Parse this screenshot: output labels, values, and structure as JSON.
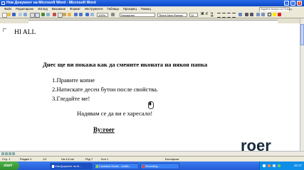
{
  "window": {
    "title": "Нов Документ на Microsoft Word - Microsoft Word",
    "help_placeholder": "Задайте въпрос за Помощ",
    "controls": {
      "minimize": "_",
      "maximize": "□",
      "close": "x"
    }
  },
  "menu": [
    "Файл",
    "Редактиране",
    "Изглед",
    "Вмъкване",
    "Формат",
    "Инструменти",
    "Таблица",
    "Прозорец",
    "Помощ"
  ],
  "toolbar": {
    "zoom": "100%",
    "style": "Нормален",
    "font": "Times New Roman",
    "font_size": "12"
  },
  "document": {
    "heading": "HI ALL",
    "intro": "Днес ще ви покажа как да смените иконата на някоя папка",
    "steps": [
      "1.Правите копие",
      "2.Натискате десен бутон после свойства.",
      "3.Гледайте ме!"
    ],
    "closing": "Надявам се да ви е харесало!",
    "signature": "By:roer"
  },
  "watermark": "roer",
  "statusbar": {
    "page": "Стр. 1",
    "section": "Раздел 1",
    "page_of": "1/1",
    "at": "На 4,8 см",
    "line": "Ред 7",
    "column": "Кол 1",
    "language": "Български"
  },
  "taskbar": {
    "start": "start",
    "tasks": [
      "Нов Документ на М...",
      "Camtasia Studio - Untitle...",
      "Recording..."
    ],
    "clock": "16:17"
  },
  "colors": {
    "titlebar": "#0a46c8",
    "taskbar": "#2259d6",
    "start_button": "#2f8f2c"
  }
}
